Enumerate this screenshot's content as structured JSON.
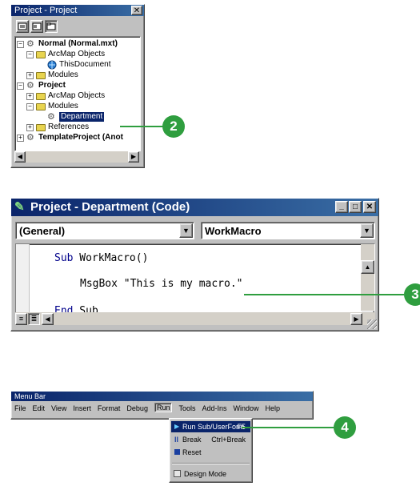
{
  "project_explorer": {
    "title": "Project - Project",
    "tree": [
      {
        "label": "Normal (Normal.mxt)",
        "bold": true,
        "expand": "−"
      },
      {
        "label": "ArcMap Objects",
        "expand": "−"
      },
      {
        "label": "ThisDocument"
      },
      {
        "label": "Modules",
        "expand": "+"
      },
      {
        "label": "Project",
        "bold": true,
        "expand": "−"
      },
      {
        "label": "ArcMap Objects",
        "expand": "+"
      },
      {
        "label": "Modules",
        "expand": "−"
      },
      {
        "label": "Department",
        "selected": true
      },
      {
        "label": "References",
        "expand": "+"
      },
      {
        "label": "TemplateProject (Anot",
        "bold": true,
        "expand": "+"
      }
    ]
  },
  "code_window": {
    "title": "Project - Department (Code)",
    "object_combo": "(General)",
    "proc_combo": "WorkMacro",
    "lines": {
      "l1_kw": "Sub",
      "l1_rest": " WorkMacro()",
      "l2": "MsgBox \"This is my macro.\"",
      "l3_kw": "End",
      "l3_rest": " Sub"
    }
  },
  "menu_bar": {
    "title": "Menu Bar",
    "items": [
      "File",
      "Edit",
      "View",
      "Insert",
      "Format",
      "Debug",
      "Run",
      "Tools",
      "Add-Ins",
      "Window",
      "Help"
    ],
    "run_menu": [
      {
        "label": "Run Sub/UserForm",
        "shortcut": "F5",
        "highlighted": true
      },
      {
        "label": "Break",
        "shortcut": "Ctrl+Break"
      },
      {
        "label": "Reset",
        "shortcut": ""
      },
      {
        "label": "Design Mode",
        "shortcut": ""
      }
    ]
  },
  "callouts": [
    "2",
    "3",
    "4"
  ],
  "colors": {
    "callout": "#2f9e3f",
    "titlebar": "#0a246a",
    "selection": "#0a246a"
  }
}
